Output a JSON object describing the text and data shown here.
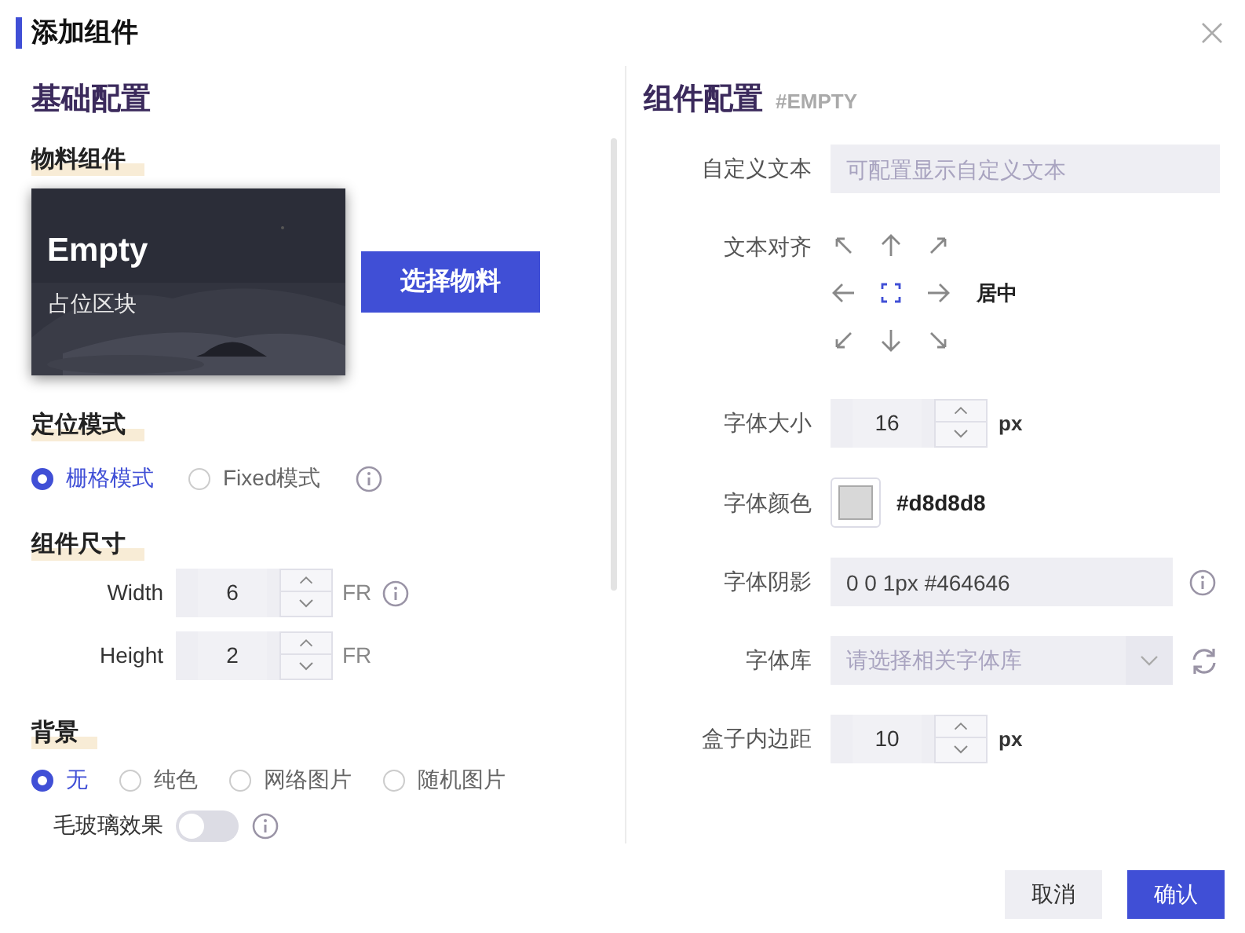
{
  "dialog": {
    "title": "添加组件"
  },
  "basic": {
    "heading": "基础配置",
    "material": {
      "label": "物料组件",
      "card_title": "Empty",
      "card_subtitle": "占位区块",
      "button": "选择物料"
    },
    "position": {
      "label": "定位模式",
      "info": true,
      "options": [
        {
          "label": "栅格模式",
          "selected": true
        },
        {
          "label": "Fixed模式",
          "selected": false
        }
      ]
    },
    "size": {
      "label": "组件尺寸",
      "fields": [
        {
          "label": "Width",
          "value": "6",
          "unit": "FR",
          "info": true
        },
        {
          "label": "Height",
          "value": "2",
          "unit": "FR",
          "info": false
        }
      ]
    },
    "background": {
      "label": "背景",
      "options": [
        {
          "label": "无",
          "selected": true
        },
        {
          "label": "纯色",
          "selected": false
        },
        {
          "label": "网络图片",
          "selected": false
        },
        {
          "label": "随机图片",
          "selected": false
        }
      ]
    },
    "glass": {
      "label": "毛玻璃效果",
      "on": false,
      "info": true
    }
  },
  "component": {
    "heading": "组件配置",
    "tag": "#EMPTY",
    "rows": [
      {
        "kind": "text",
        "label": "自定义文本",
        "placeholder": "可配置显示自定义文本"
      },
      {
        "kind": "align",
        "label": "文本对齐",
        "cells": [
          {
            "selected": false
          },
          {
            "selected": false
          },
          {
            "selected": false
          },
          {
            "selected": false
          },
          {
            "selected": true
          },
          {
            "selected": false
          },
          {
            "selected": false
          },
          {
            "selected": false
          },
          {
            "selected": false
          }
        ],
        "current": "居中"
      },
      {
        "kind": "number",
        "label": "字体大小",
        "value": "16",
        "unit": "px"
      },
      {
        "kind": "color",
        "label": "字体颜色",
        "color": "#d8d8d8",
        "value": "#d8d8d8"
      },
      {
        "kind": "input",
        "label": "字体阴影",
        "value": "0 0 1px #464646",
        "info": true
      },
      {
        "kind": "select",
        "label": "字体库",
        "placeholder": "请选择相关字体库"
      },
      {
        "kind": "number",
        "label": "盒子内边距",
        "value": "10",
        "unit": "px"
      }
    ]
  },
  "footer": {
    "buttons": [
      {
        "label": "取消",
        "kind": "secondary"
      },
      {
        "label": "确认",
        "kind": "primary"
      }
    ]
  }
}
